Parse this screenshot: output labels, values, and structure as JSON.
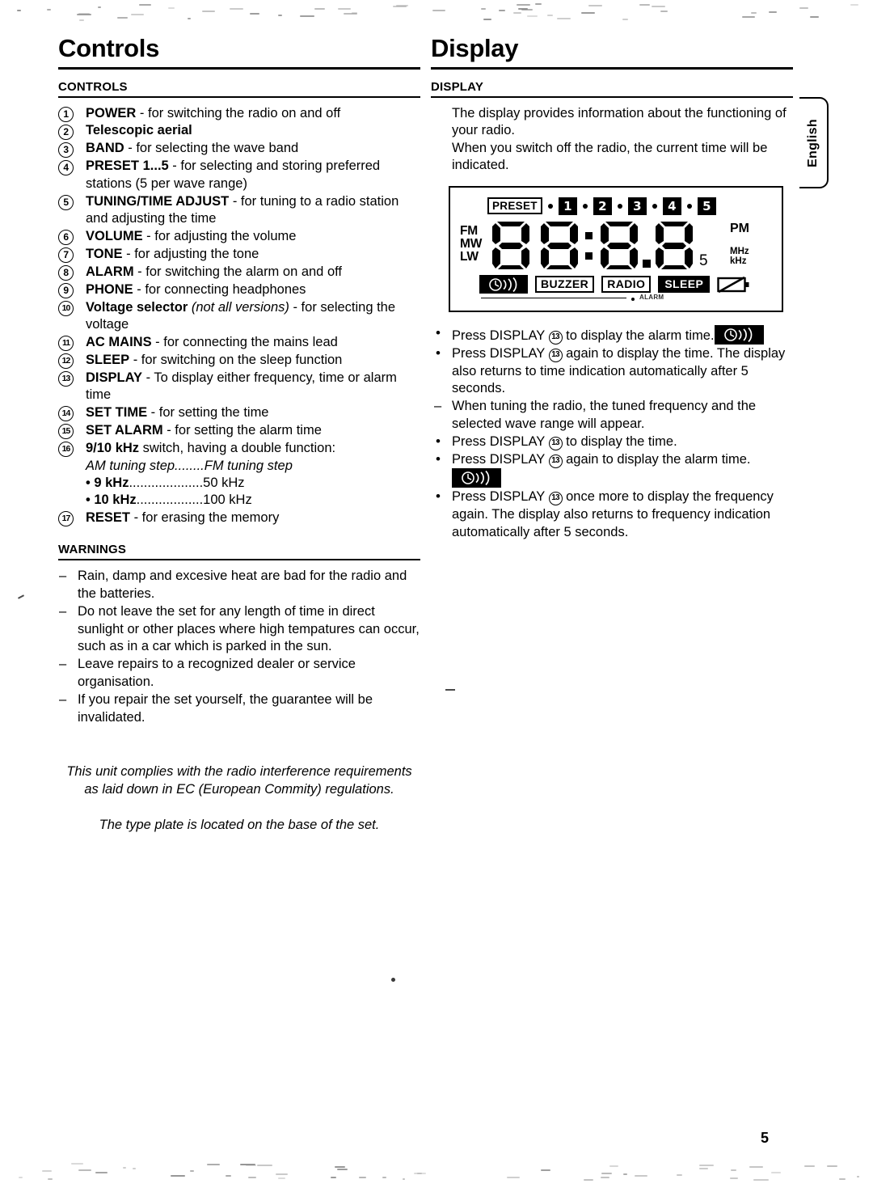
{
  "page": {
    "number": "5",
    "side_tab": "English"
  },
  "left": {
    "title": "Controls",
    "section_heading": "CONTROLS",
    "items": [
      {
        "n": "1",
        "bold": "POWER",
        "rest": " - for switching the radio on and off"
      },
      {
        "n": "2",
        "bold": "Telescopic aerial",
        "rest": ""
      },
      {
        "n": "3",
        "bold": "BAND",
        "rest": " - for selecting the wave band"
      },
      {
        "n": "4",
        "bold": "PRESET 1...5",
        "rest": " - for selecting and storing preferred stations (5 per wave range)"
      },
      {
        "n": "5",
        "bold": "TUNING/TIME ADJUST",
        "rest": " - for tuning to a radio station and adjusting the time"
      },
      {
        "n": "6",
        "bold": "VOLUME",
        "rest": " - for adjusting the volume"
      },
      {
        "n": "7",
        "bold": "TONE",
        "rest": " - for adjusting the tone"
      },
      {
        "n": "8",
        "bold": "ALARM",
        "rest": " - for switching the alarm on and off"
      },
      {
        "n": "9",
        "bold": "PHONE",
        "rest": " - for connecting headphones"
      },
      {
        "n": "10",
        "bold": "Voltage selector",
        "italic": " (not all versions)",
        "rest": " - for selecting the voltage"
      },
      {
        "n": "11",
        "bold": "AC MAINS",
        "rest": " - for connecting the mains lead"
      },
      {
        "n": "12",
        "bold": "SLEEP",
        "rest": " - for switching on the sleep function"
      },
      {
        "n": "13",
        "bold": "DISPLAY",
        "rest": " - To display either frequency, time or alarm time"
      },
      {
        "n": "14",
        "bold": "SET TIME",
        "rest": " - for setting the time"
      },
      {
        "n": "15",
        "bold": "SET ALARM",
        "rest": " - for setting the alarm time"
      },
      {
        "n": "16",
        "bold": "9/10 kHz",
        "rest": " switch, having a double function:"
      },
      {
        "n": "17",
        "bold": "RESET",
        "rest": " - for erasing the memory"
      }
    ],
    "khz_table": {
      "header": "AM tuning step........FM tuning step",
      "rows": [
        {
          "am": "9 kHz",
          "leader": "....................",
          "fm": "50 kHz"
        },
        {
          "am": "10 kHz",
          "leader": "..................",
          "fm": "100 kHz"
        }
      ]
    },
    "warnings_heading": "WARNINGS",
    "warnings": [
      "Rain, damp and excesive heat are bad for the radio and the batteries.",
      "Do not leave the set for any length of time in direct sunlight or other places where high tempatures can occur, such as in a car which is parked in the sun.",
      "Leave repairs to a recognized dealer or service organisation.",
      "If you repair the set yourself, the guarantee will be invalidated."
    ],
    "note1": "This unit complies with the radio interference requirements as laid down in EC (European Commity) regulations.",
    "note2": "The type plate is located on the base of the set."
  },
  "right": {
    "title": "Display",
    "section_heading": "DISPLAY",
    "intro": "The display provides information about the functioning of your radio.\nWhen you switch off the radio, the current time will be indicated.",
    "lcd": {
      "preset_label": "PRESET",
      "preset_numbers": [
        "1",
        "2",
        "3",
        "4",
        "5"
      ],
      "bands": [
        "FM",
        "MW",
        "LW"
      ],
      "digits": "88:88",
      "digit_subscript": "5",
      "pm_label": "PM",
      "mhz_label": "MHz",
      "khz_label": "kHz",
      "indicators": [
        {
          "name": "alarm-clock",
          "label": "",
          "style": "inverted-icon"
        },
        {
          "name": "buzzer",
          "label": "BUZZER",
          "style": "outlined"
        },
        {
          "name": "radio",
          "label": "RADIO",
          "style": "outlined"
        },
        {
          "name": "sleep",
          "label": "SLEEP",
          "style": "inverted"
        },
        {
          "name": "battery-low",
          "label": "",
          "style": "icon"
        }
      ],
      "alarm_micro_label": "ALARM"
    },
    "bullets": [
      {
        "kind": "dot",
        "text": "Press DISPLAY ",
        "ref": "13",
        "text2": " to display the alarm time.",
        "chip": true
      },
      {
        "kind": "dot",
        "text": "Press DISPLAY ",
        "ref": "13",
        "text2": " again to display the time. The display also returns to time indication automatically after 5 seconds.",
        "chip": false
      },
      {
        "kind": "dash",
        "text": "When tuning the radio, the tuned frequency and the selected wave range will appear.",
        "ref": "",
        "text2": "",
        "chip": false
      },
      {
        "kind": "dot",
        "text": "Press DISPLAY ",
        "ref": "13",
        "text2": " to display the time.",
        "chip": false
      },
      {
        "kind": "dot",
        "text": "Press DISPLAY ",
        "ref": "13",
        "text2": "  again to display the alarm time. ",
        "chip": true
      },
      {
        "kind": "dot",
        "text": "Press DISPLAY ",
        "ref": "13",
        "text2": " once more to display the frequency again. The display also returns to frequency indication automatically after 5 seconds.",
        "chip": false
      }
    ]
  }
}
